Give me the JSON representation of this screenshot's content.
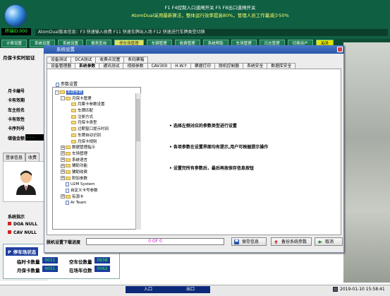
{
  "header": {
    "status_lcd": "终端ID:000",
    "marquee_line1": "F1 F4控制入口道闸开关  F5 F8出口道闸开关",
    "marquee_line2": "AtomDual采用最新算法，整体运行效率提高80%，管理人员工作量减少50%",
    "strip_text": "AtomDual版本信息：F3 快速输入收费   F11 快速车牌出入场   F12 快速进行车牌类型切换"
  },
  "navbar": {
    "items": [
      "计费设置",
      "系统设置",
      "系统设置",
      "报表查询",
      "停车场管理",
      "车辆管理",
      "收费管理",
      "系统帮助",
      "车场管理",
      "日志管理",
      "切换用户",
      "关闭"
    ]
  },
  "left_panel": {
    "title": "月保卡实时验证",
    "fields": [
      "月卡编号",
      "卡有效期",
      "车主姓名",
      "卡有效性",
      "卡序列号",
      "储值金额"
    ],
    "lcd_value": "- - -",
    "tab1": "登录信息",
    "tab2": "收费",
    "status_title": "系统指示",
    "status_items": [
      {
        "label": "DOA NULL",
        "color": "#d42020"
      },
      {
        "label": "CAV NULL",
        "color": "#d42020"
      }
    ]
  },
  "parking": {
    "title": "停车场状态",
    "rows": [
      {
        "label": "临时卡数量",
        "value": "0011",
        "label2": "空车位数量",
        "value2": "0938"
      },
      {
        "label": "月保卡数量",
        "value": "0051",
        "label2": "在场车位数",
        "value2": "0062"
      }
    ]
  },
  "dialog": {
    "title": "系统设置",
    "tabs_row1": [
      "设备测试",
      "DCA测试",
      "收费点设置",
      "条码票箱"
    ],
    "tabs_row2": [
      "设备管理器",
      "系统参数",
      "通讯测试",
      "视频参数",
      "CAV300",
      "H.W.Y",
      "票据打印",
      "脱机控制器",
      "系统安全",
      "数据库安全"
    ],
    "active_tab_index": 1,
    "tree_header": "参数设置",
    "tree": [
      {
        "label": "系统参数",
        "indent": 0,
        "type": "folder",
        "expand": "-",
        "selected": true
      },
      {
        "label": "月保卡管理",
        "indent": 1,
        "type": "folder",
        "expand": "-"
      },
      {
        "label": "月票卡参数设置",
        "indent": 2,
        "type": "folder"
      },
      {
        "label": "车牌匹配",
        "indent": 2,
        "type": "folder"
      },
      {
        "label": "注册方式",
        "indent": 2,
        "type": "folder"
      },
      {
        "label": "月保卡类型",
        "indent": 2,
        "type": "folder"
      },
      {
        "label": "过期窗口提示时间",
        "indent": 2,
        "type": "folder"
      },
      {
        "label": "车牌自动识别",
        "indent": 2,
        "type": "folder"
      },
      {
        "label": "月保卡规则",
        "indent": 2,
        "type": "folder"
      },
      {
        "label": "数据管理指示",
        "indent": 1,
        "type": "folder",
        "expand": "+"
      },
      {
        "label": "车场管理",
        "indent": 1,
        "type": "folder",
        "expand": "+"
      },
      {
        "label": "系统语言",
        "indent": 1,
        "type": "folder",
        "expand": "+"
      },
      {
        "label": "辅助功能",
        "indent": 1,
        "type": "folder",
        "expand": "+"
      },
      {
        "label": "辅助收费",
        "indent": 1,
        "type": "folder",
        "expand": "+"
      },
      {
        "label": "附加参数",
        "indent": 1,
        "type": "folder",
        "expand": "+"
      },
      {
        "label": "U2M System",
        "indent": 1,
        "type": "leaf"
      },
      {
        "label": "自定义卡号参数",
        "indent": 1,
        "type": "leaf"
      },
      {
        "label": "有源卡",
        "indent": 1,
        "type": "folder",
        "expand": "+"
      },
      {
        "label": "Ar Team",
        "indent": 1,
        "type": "leaf"
      }
    ],
    "hints": [
      "• 选择左侧对应的参数类型进行设置",
      "• 各项参数在设置界面均有提示,用户可根据提示操作",
      "• 设置完所有参数后，最后再按保存信息按钮"
    ],
    "download_label": "脱机设置下载进度",
    "progress_text": "0 OF 0",
    "progress_value": 0,
    "buttons": {
      "save": "保存信息",
      "backup": "备份系统参数",
      "cancel": "取消"
    }
  },
  "statusbar": {
    "entry": "入口",
    "exit": "出口",
    "datetime": "2019-01-10 15:58:41"
  }
}
